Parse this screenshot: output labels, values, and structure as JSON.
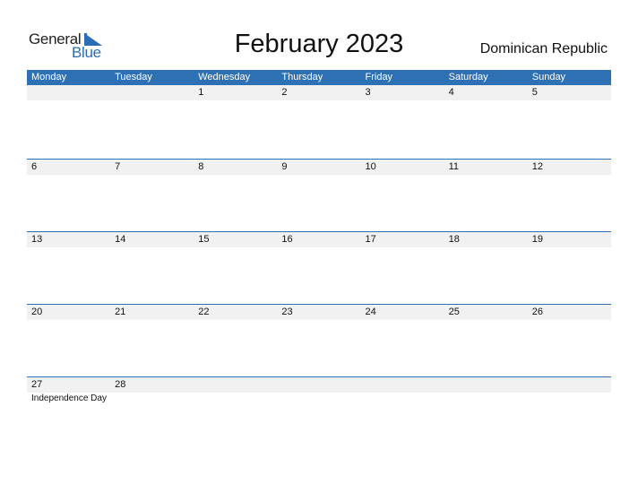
{
  "logo": {
    "word1": "General",
    "word2": "Blue"
  },
  "title": "February 2023",
  "country": "Dominican Republic",
  "colors": {
    "accent": "#2e70b4",
    "row_bg": "#f1f1f1"
  },
  "weekdays": [
    "Monday",
    "Tuesday",
    "Wednesday",
    "Thursday",
    "Friday",
    "Saturday",
    "Sunday"
  ],
  "weeks": [
    {
      "days": [
        "",
        "",
        "1",
        "2",
        "3",
        "4",
        "5"
      ],
      "events": [
        "",
        "",
        "",
        "",
        "",
        "",
        ""
      ]
    },
    {
      "days": [
        "6",
        "7",
        "8",
        "9",
        "10",
        "11",
        "12"
      ],
      "events": [
        "",
        "",
        "",
        "",
        "",
        "",
        ""
      ]
    },
    {
      "days": [
        "13",
        "14",
        "15",
        "16",
        "17",
        "18",
        "19"
      ],
      "events": [
        "",
        "",
        "",
        "",
        "",
        "",
        ""
      ]
    },
    {
      "days": [
        "20",
        "21",
        "22",
        "23",
        "24",
        "25",
        "26"
      ],
      "events": [
        "",
        "",
        "",
        "",
        "",
        "",
        ""
      ]
    },
    {
      "days": [
        "27",
        "28",
        "",
        "",
        "",
        "",
        ""
      ],
      "events": [
        "Independence Day",
        "",
        "",
        "",
        "",
        "",
        ""
      ]
    }
  ]
}
